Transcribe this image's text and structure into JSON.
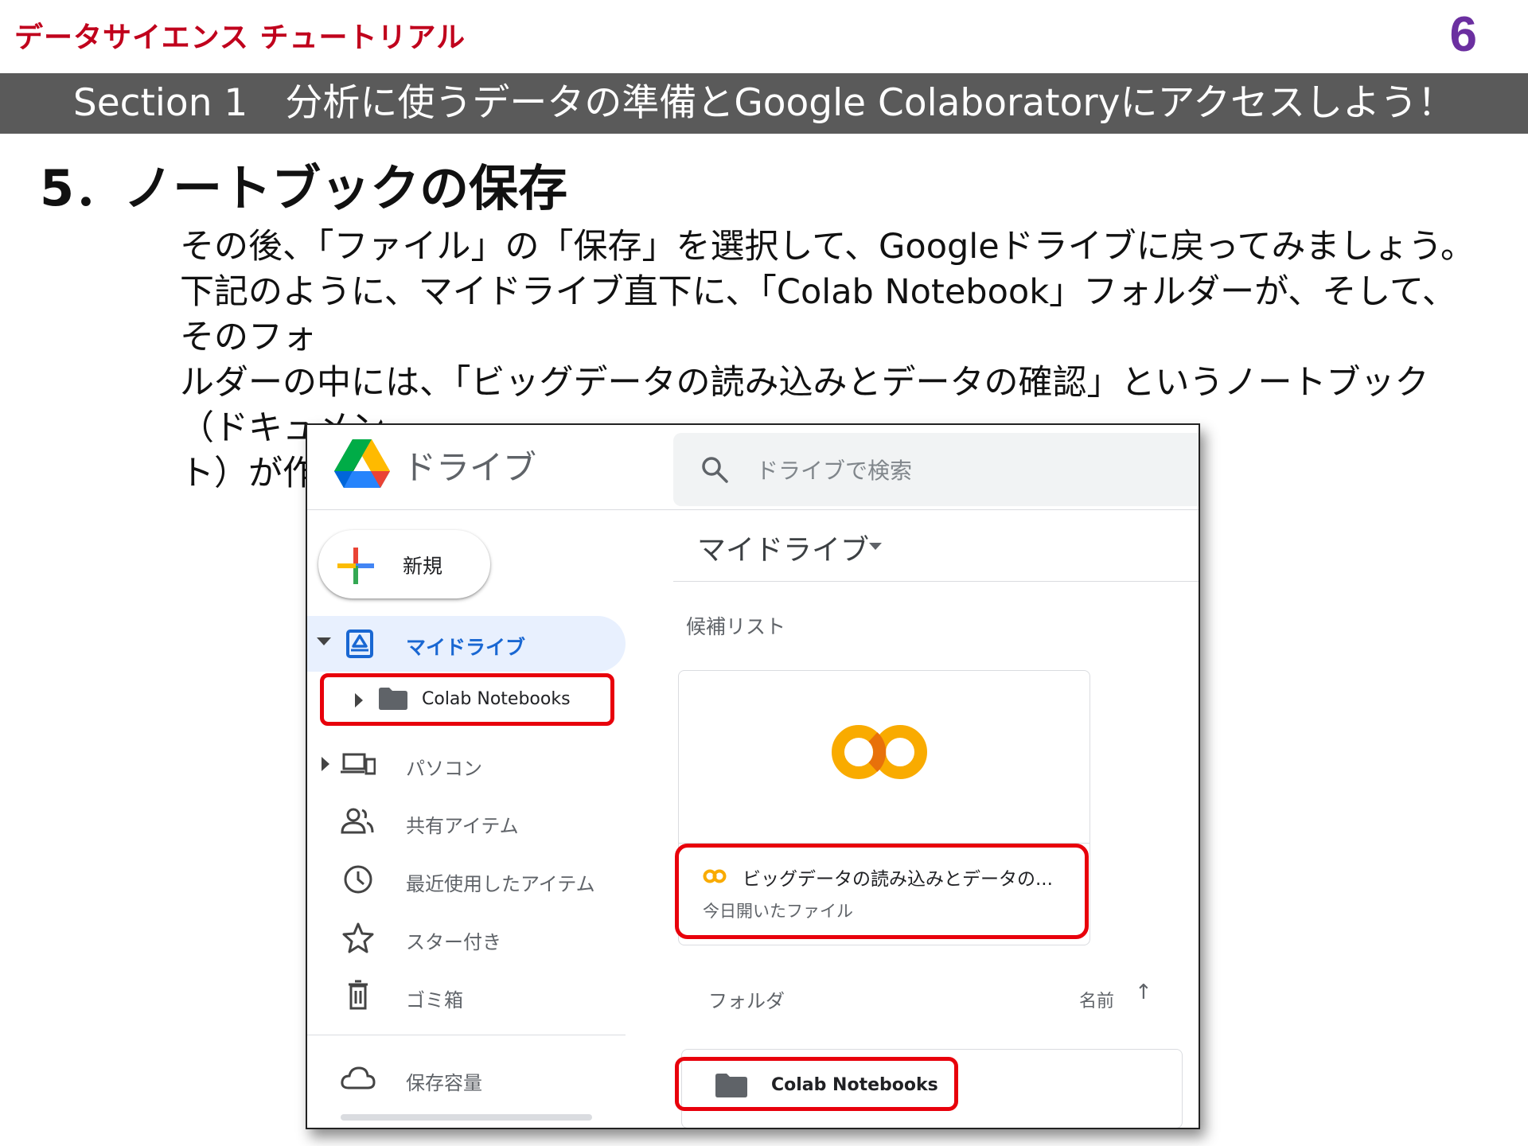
{
  "header": {
    "brand": "データサイエンス チュートリアル",
    "page_number": "6",
    "section": "Section 1　分析に使うデータの準備とGoogle Colaboratoryにアクセスしよう！",
    "title": "5．ノートブックの保存"
  },
  "body": {
    "line1": "その後、「ファイル」の「保存」を選択して、Googleドライブに戻ってみましょう。",
    "line2": "下記のように、マイドライブ直下に、「Colab Notebook」フォルダーが、そして、そのフォ",
    "line3": "ルダーの中には、「ビッグデータの読み込みとデータの確認」というノートブック（ドキュメン",
    "line4": "ト）が作成されているでしょう。"
  },
  "drive": {
    "app_name": "ドライブ",
    "search_placeholder": "ドライブで検索",
    "new_button": "新規",
    "sidebar": {
      "my_drive": "マイドライブ",
      "colab_folder": "Colab Notebooks",
      "computers": "パソコン",
      "shared": "共有アイテム",
      "recent": "最近使用したアイテム",
      "starred": "スター付き",
      "trash": "ゴミ箱",
      "storage": "保存容量"
    },
    "breadcrumb": "マイドライブ",
    "suggested_title": "候補リスト",
    "suggested_card": {
      "title": "ビッグデータの読み込みとデータの...",
      "subtitle": "今日開いたファイル"
    },
    "folders_title": "フォルダ",
    "sort_label": "名前",
    "sort_arrow": "↑",
    "folder_name": "Colab Notebooks"
  },
  "colors": {
    "brand_red": "#c0001c",
    "page_number_purple": "#6b2fa0",
    "section_band": "#5a5a5a",
    "highlight_red": "#e8000b",
    "drive_active_blue": "#1967d2",
    "colab_orange": "#f9ab00"
  },
  "icons": [
    "drive-logo-icon",
    "search-icon",
    "plus-icon",
    "my-drive-icon",
    "folder-icon",
    "computers-icon",
    "people-icon",
    "clock-icon",
    "star-icon",
    "trash-icon",
    "cloud-icon",
    "colab-logo-icon",
    "arrow-up-icon"
  ]
}
